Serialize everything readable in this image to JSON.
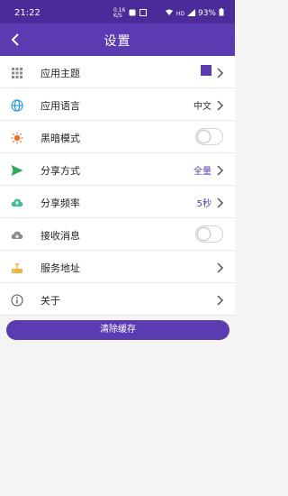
{
  "status_bar": {
    "time": "21:22",
    "battery": "93%",
    "net_speed_top": "0.16",
    "net_speed_bottom": "K/S"
  },
  "app_bar": {
    "title": "设置"
  },
  "settings": {
    "theme": {
      "label": "应用主题",
      "swatch_color": "#5b3bb1"
    },
    "language": {
      "label": "应用语言",
      "value": "中文"
    },
    "dark_mode": {
      "label": "黑暗模式",
      "enabled": false
    },
    "share_method": {
      "label": "分享方式",
      "value": "全量"
    },
    "share_frequency": {
      "label": "分享频率",
      "value": "5秒"
    },
    "receive_messages": {
      "label": "接收消息",
      "enabled": false
    },
    "server_address": {
      "label": "服务地址"
    },
    "about": {
      "label": "关于"
    }
  },
  "actions": {
    "clear_cache_label": "清除缓存"
  },
  "colors": {
    "primary": "#5b3bb1",
    "status_bar": "#4b2a9a",
    "globe_icon": "#2d9be2",
    "sun_icon": "#f06a2a",
    "send_icon": "#2eaa57",
    "cloud_icon": "#3bbf8f",
    "download_cloud_icon": "#8a8a8a",
    "server_icon": "#f2b13a",
    "grid_icon": "#8a8a8a"
  }
}
